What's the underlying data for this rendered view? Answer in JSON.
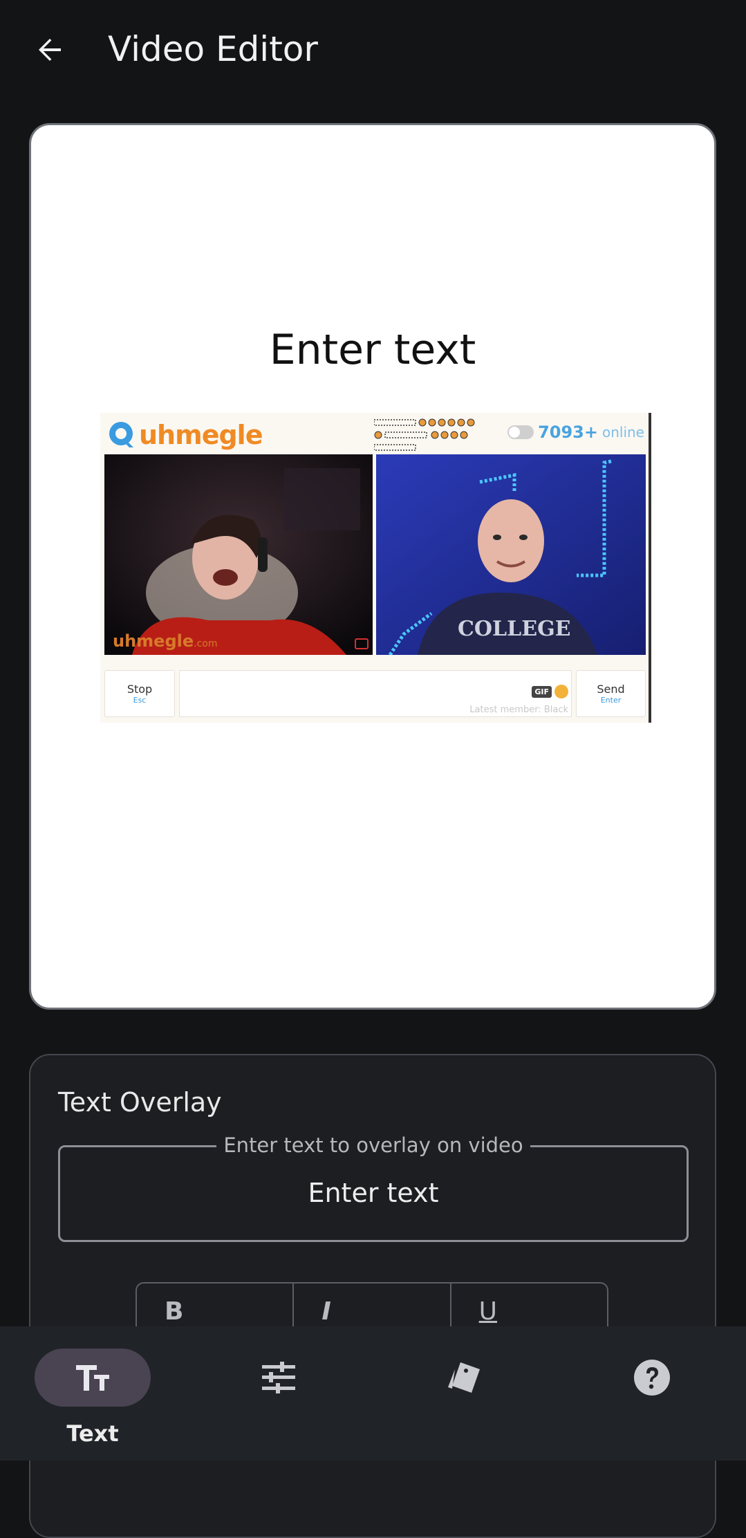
{
  "appbar": {
    "title": "Video Editor"
  },
  "preview": {
    "overlay_text": "Enter text",
    "frame": {
      "logo_text": "uhmegle",
      "online_count": "7093+",
      "online_label": "online",
      "watermark_main": "uhmegle",
      "watermark_suffix": ".com",
      "stop_label": "Stop",
      "stop_key": "Esc",
      "send_label": "Send",
      "send_key": "Enter",
      "gif_label": "GIF",
      "latest_member": "Latest member: Black"
    }
  },
  "panel": {
    "title": "Text Overlay",
    "field_label": "Enter text to overlay on video",
    "field_value": "Enter text",
    "format_buttons": {
      "bold": "B",
      "italic": "I",
      "underline": "U"
    }
  },
  "bottom_nav": {
    "items": [
      {
        "id": "text",
        "label": "Text",
        "icon": "text-format-icon",
        "active": true
      },
      {
        "id": "adjust",
        "label": "",
        "icon": "tune-icon",
        "active": false
      },
      {
        "id": "style",
        "label": "",
        "icon": "style-cards-icon",
        "active": false
      },
      {
        "id": "help",
        "label": "",
        "icon": "help-icon",
        "active": false
      }
    ]
  }
}
